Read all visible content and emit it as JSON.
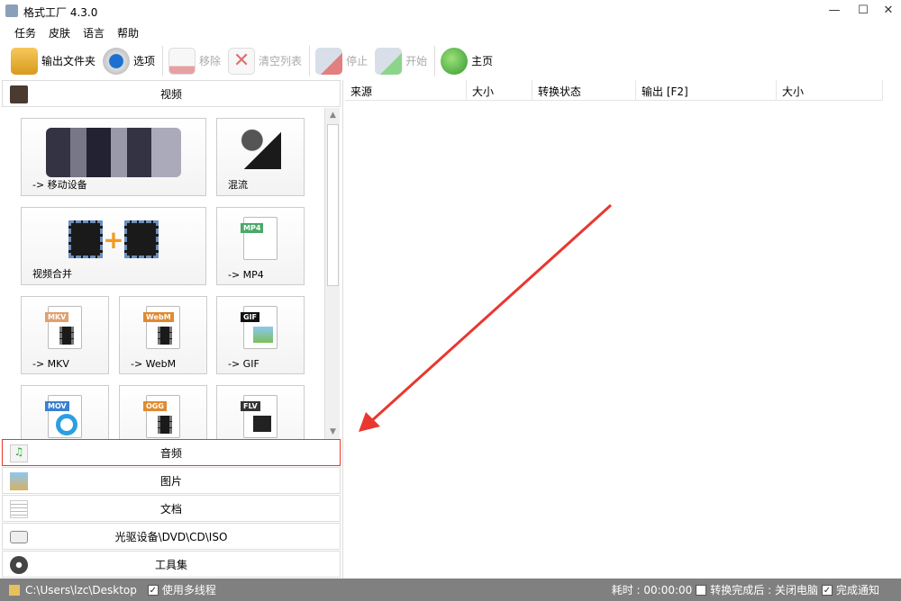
{
  "window": {
    "title": "格式工厂 4.3.0",
    "minimize": "—",
    "maximize": "☐",
    "close": "✕"
  },
  "menu": [
    "任务",
    "皮肤",
    "语言",
    "帮助"
  ],
  "toolbar": {
    "output_folder": "输出文件夹",
    "options": "选项",
    "remove": "移除",
    "clear_list": "清空列表",
    "stop": "停止",
    "start": "开始",
    "home": "主页"
  },
  "left": {
    "video": "视频",
    "tiles": [
      {
        "label": "-> 移动设备"
      },
      {
        "label": "混流"
      },
      {
        "label": "视频合并"
      },
      {
        "label": "-> MP4",
        "tag": "MP4"
      },
      {
        "label": "-> MKV",
        "tag": "MKV"
      },
      {
        "label": "-> WebM",
        "tag": "WebM"
      },
      {
        "label": "-> GIF",
        "tag": "GIF"
      },
      {
        "label": "",
        "tag": "MOV"
      },
      {
        "label": "",
        "tag": "OGG"
      },
      {
        "label": "",
        "tag": "FLV"
      }
    ],
    "categories": [
      "音频",
      "图片",
      "文档",
      "光驱设备\\DVD\\CD\\ISO",
      "工具集"
    ]
  },
  "table": {
    "columns": [
      "来源",
      "大小",
      "转换状态",
      "输出 [F2]",
      "大小"
    ]
  },
  "status": {
    "path": "C:\\Users\\lzc\\Desktop",
    "multithread": "使用多线程",
    "elapsed": "耗时 : 00:00:00",
    "shutdown": "转换完成后 : 关闭电脑",
    "notify": "完成通知",
    "check": "✓"
  },
  "colors": {
    "annotation": "#e8382f",
    "statusbar": "#808080"
  }
}
